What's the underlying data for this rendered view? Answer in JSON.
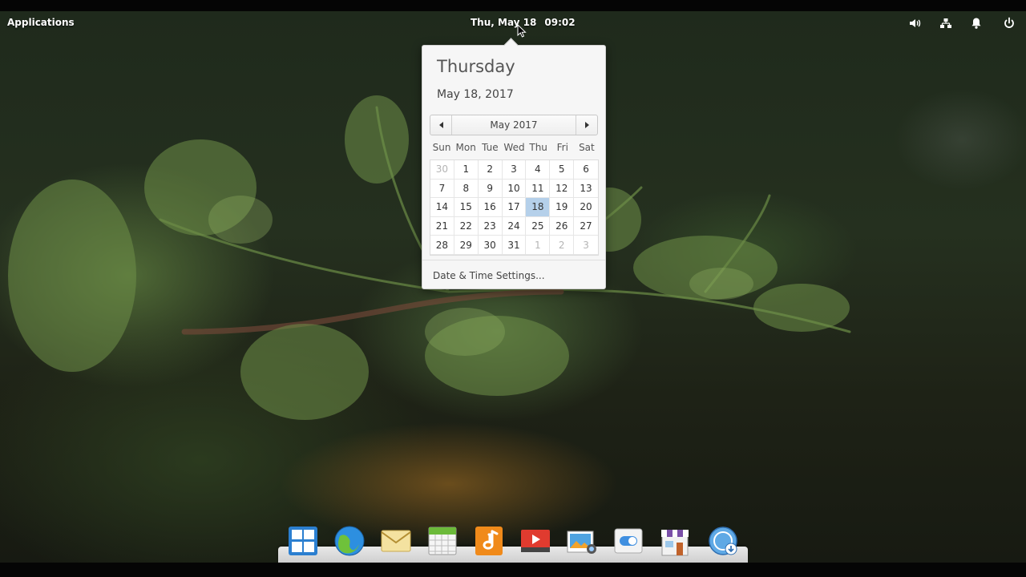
{
  "panel": {
    "applications_label": "Applications",
    "clock_date": "Thu, May 18",
    "clock_time": "09:02",
    "indicators": [
      "volume-icon",
      "network-icon",
      "notifications-icon",
      "power-icon"
    ]
  },
  "calendar": {
    "weekday": "Thursday",
    "full_date": "May 18, 2017",
    "month_label": "May 2017",
    "day_headers": [
      "Sun",
      "Mon",
      "Tue",
      "Wed",
      "Thu",
      "Fri",
      "Sat"
    ],
    "weeks": [
      [
        "30",
        "1",
        "2",
        "3",
        "4",
        "5",
        "6"
      ],
      [
        "7",
        "8",
        "9",
        "10",
        "11",
        "12",
        "13"
      ],
      [
        "14",
        "15",
        "16",
        "17",
        "18",
        "19",
        "20"
      ],
      [
        "21",
        "22",
        "23",
        "24",
        "25",
        "26",
        "27"
      ],
      [
        "28",
        "29",
        "30",
        "31",
        "1",
        "2",
        "3"
      ]
    ],
    "today": "18",
    "settings_link": "Date & Time Settings..."
  },
  "colors": {
    "today_highlight": "#b5d0ea",
    "popover_bg": "#f6f6f6"
  },
  "dock": {
    "items": [
      "multitasking-view-icon",
      "web-browser-icon",
      "mail-icon",
      "calendar-app-icon",
      "music-icon",
      "videos-icon",
      "photos-icon",
      "system-settings-icon",
      "app-center-icon",
      "installer-icon"
    ]
  }
}
